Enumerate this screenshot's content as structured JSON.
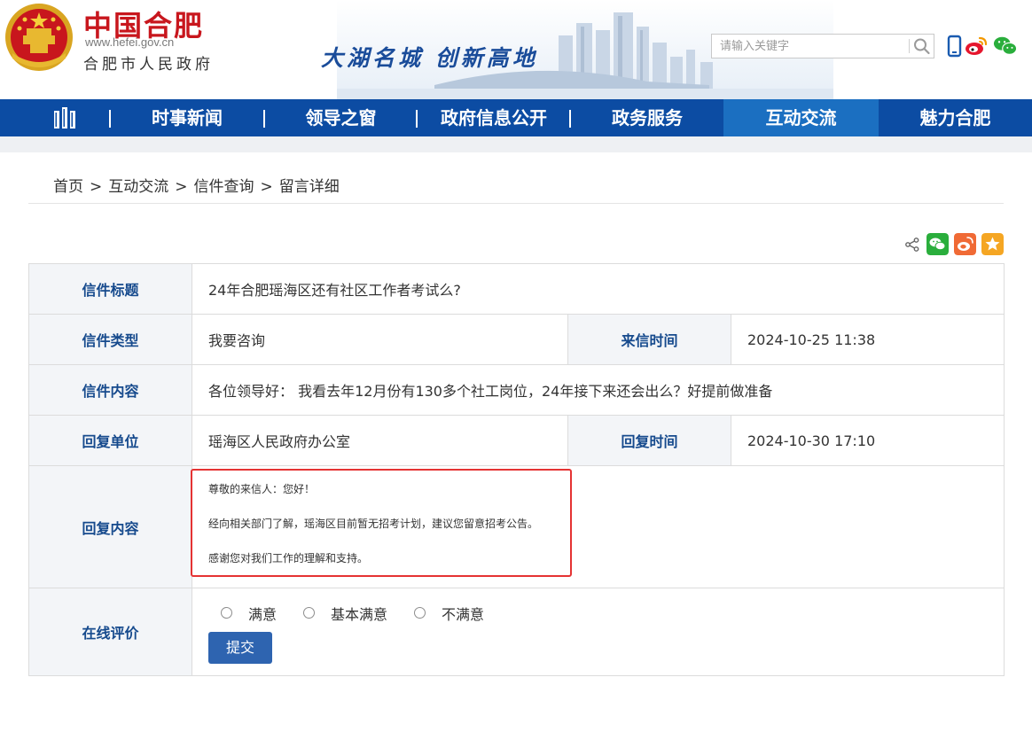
{
  "header": {
    "site_name": "中国合肥",
    "site_url": "www.hefei.gov.cn",
    "site_subtitle": "合肥市人民政府",
    "slogan": "大湖名城  创新高地",
    "search_placeholder": "请输入关键字",
    "icons": [
      "emblem-icon",
      "search-icon",
      "mobile-icon",
      "weibo-icon",
      "wechat-icon"
    ],
    "brand_red": "#c8161d",
    "brand_blue": "#0c4ca3"
  },
  "nav": {
    "items": [
      {
        "label": "时事新闻"
      },
      {
        "label": "领导之窗"
      },
      {
        "label": "政府信息公开"
      },
      {
        "label": "政务服务"
      },
      {
        "label": "互动交流",
        "active": true
      },
      {
        "label": "魅力合肥"
      }
    ],
    "active_color": "#1b6fc1"
  },
  "breadcrumb": {
    "items": [
      "首页",
      "互动交流",
      "信件查询",
      "留言详细"
    ],
    "separator": ">"
  },
  "share": {
    "icons": [
      "share-icon",
      "wechat-share-icon",
      "weibo-share-icon",
      "favorite-star-icon"
    ]
  },
  "letter": {
    "title_label": "信件标题",
    "title": "24年合肥瑶海区还有社区工作者考试么?",
    "type_label": "信件类型",
    "type": "我要咨询",
    "time_label": "来信时间",
    "time": "2024-10-25 11:38",
    "content_label": "信件内容",
    "content": "各位领导好： 我看去年12月份有130多个社工岗位，24年接下来还会出么？好提前做准备",
    "reply_unit_label": "回复单位",
    "reply_unit": "瑶海区人民政府办公室",
    "reply_time_label": "回复时间",
    "reply_time": "2024-10-30 17:10",
    "reply_content_label": "回复内容",
    "reply_lines": [
      "尊敬的来信人：您好！",
      "经向相关部门了解，瑶海区目前暂无招考计划，建议您留意招考公告。",
      "感谢您对我们工作的理解和支持。"
    ],
    "highlight_color": "#e53333"
  },
  "rating": {
    "label": "在线评价",
    "options": [
      "满意",
      "基本满意",
      "不满意"
    ],
    "submit_label": "提交"
  }
}
